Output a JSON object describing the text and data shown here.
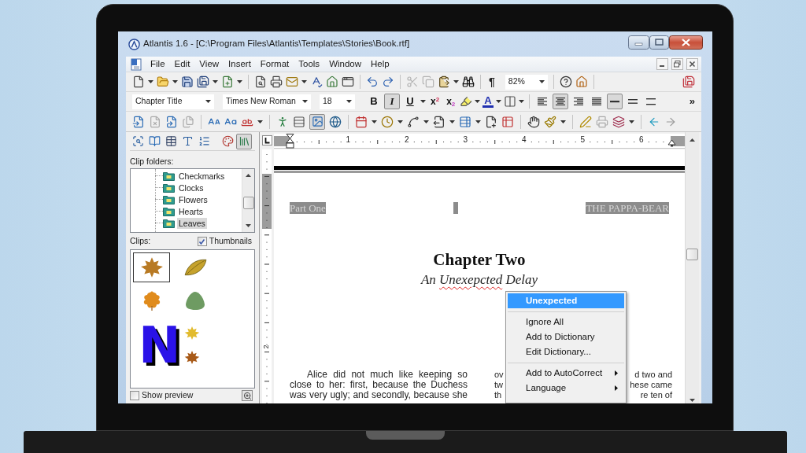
{
  "window": {
    "title": "Atlantis 1.6 - [C:\\Program Files\\Atlantis\\Templates\\Stories\\Book.rtf]"
  },
  "menu": [
    "File",
    "Edit",
    "View",
    "Insert",
    "Format",
    "Tools",
    "Window",
    "Help"
  ],
  "standard_toolbar": {
    "cut": {
      "disabled": true
    },
    "copy": {
      "disabled": true
    },
    "formatting_marks": "¶",
    "zoom": "82%"
  },
  "format_toolbar": {
    "style": "Chapter Title",
    "font": "Times New Roman",
    "size": "18",
    "toggles": [
      {
        "kind": "bold",
        "label": "B",
        "on": false
      },
      {
        "kind": "italic",
        "label": "I",
        "on": true
      },
      {
        "kind": "underline",
        "label": "U",
        "on": false
      }
    ],
    "scripts": [
      {
        "kind": "superscript",
        "label": "x$^{2}$"
      },
      {
        "kind": "subscript",
        "label": "x$_{2}$"
      }
    ],
    "font_color": "A",
    "alignment": [
      {
        "kind": "left",
        "selected": false
      },
      {
        "kind": "center",
        "selected": true
      },
      {
        "kind": "right",
        "selected": false
      },
      {
        "kind": "justify",
        "selected": false
      }
    ],
    "spacing": [
      {
        "kind": "single",
        "selected": true
      },
      {
        "kind": "one_half",
        "selected": false
      },
      {
        "kind": "double",
        "selected": false
      }
    ],
    "more": "»"
  },
  "object_toolbar": {
    "picture_toggle_on": true
  },
  "side_panel": {
    "tabs": [
      {
        "selected": false
      },
      {
        "selected": false
      },
      {
        "selected": false
      },
      {
        "selected": false
      },
      {
        "selected": false
      },
      {
        "selected": false
      },
      {
        "selected": true
      }
    ],
    "folders_label": "Clip folders:",
    "folders": [
      {
        "name": "Checkmarks",
        "selected": false
      },
      {
        "name": "Clocks",
        "selected": false
      },
      {
        "name": "Flowers",
        "selected": false
      },
      {
        "name": "Hearts",
        "selected": false
      },
      {
        "name": "Leaves",
        "selected": true
      }
    ],
    "clips_label": "Clips:",
    "thumbnails": {
      "label": "Thumbnails",
      "checked": true
    },
    "clips": [
      {
        "kind": "maple",
        "color": "#b87a24",
        "selected": true
      },
      {
        "kind": "oval",
        "color": "#c6a22c",
        "selected": false
      },
      {
        "kind": "oak",
        "color": "#e08b1c",
        "selected": false
      },
      {
        "kind": "round",
        "color": "#6e9b62",
        "selected": false
      },
      {
        "kind": "letter",
        "letter": "N",
        "color": "#2a12e8",
        "selected": false
      }
    ],
    "show_preview": {
      "label": "Show preview",
      "checked": false
    }
  },
  "ruler": {
    "numbers": [
      "1",
      "2",
      "3",
      "4",
      "5",
      "6"
    ]
  },
  "vertical_ruler": {
    "numbers": [
      "2"
    ]
  },
  "document": {
    "header": {
      "left": "Part One",
      "right": "THE PAPPA-BEAR"
    },
    "title": "Chapter Two",
    "subtitle": {
      "before": "An ",
      "misspelled": "Unexepcted",
      "after": " Delay"
    },
    "left_column": "Alice did not much like keeping so close to her: first, because the Duchess was very ugly; and secondly, because she",
    "right_column": [
      {
        "start": "ov",
        "end": "d two and"
      },
      {
        "start": "tw",
        "end": "hese came"
      },
      {
        "start": "th",
        "end": "re ten of"
      }
    ]
  },
  "context_menu": {
    "items": [
      {
        "kind": "suggestion",
        "label": "Unexpected",
        "selected": true
      },
      {
        "kind": "separator"
      },
      {
        "kind": "item",
        "label": "Ignore All",
        "selected": false
      },
      {
        "kind": "item",
        "label": "Add to Dictionary",
        "selected": false
      },
      {
        "kind": "item",
        "label": "Edit Dictionary...",
        "selected": false
      },
      {
        "kind": "separator"
      },
      {
        "kind": "submenu",
        "label": "Add to AutoCorrect",
        "selected": false
      },
      {
        "kind": "submenu",
        "label": "Language",
        "selected": false
      }
    ]
  }
}
